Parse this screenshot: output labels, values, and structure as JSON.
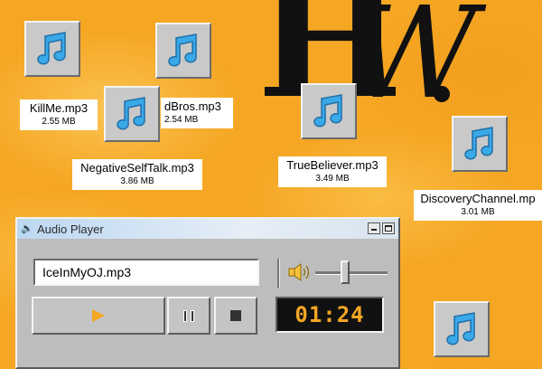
{
  "background": {
    "accent": "#f5a623",
    "brand_initials": [
      "H",
      "W"
    ]
  },
  "desktop": {
    "files": [
      {
        "name": "KillMe.mp3",
        "size": "2.55 MB",
        "icon": "music-note-icon"
      },
      {
        "name": "dBros.mp3",
        "size": "2.54 MB",
        "icon": "music-note-icon"
      },
      {
        "name": "NegativeSelfTalk.mp3",
        "size": "3.86 MB",
        "icon": "music-note-icon"
      },
      {
        "name": "TrueBeliever.mp3",
        "size": "3.49 MB",
        "icon": "music-note-icon"
      },
      {
        "name": "DiscoveryChannel.mp",
        "size": "3.01 MB",
        "icon": "music-note-icon"
      },
      {
        "name": "",
        "size": "",
        "icon": "music-note-icon"
      }
    ]
  },
  "player": {
    "title": "Audio Player",
    "track": "IceInMyOJ.mp3",
    "time": "01:24",
    "volume_icon": "speaker-icon",
    "controls": [
      "play-icon",
      "pause-icon",
      "stop-icon"
    ],
    "colors": {
      "display_bg": "#111111",
      "display_text": "#f5a623"
    }
  }
}
